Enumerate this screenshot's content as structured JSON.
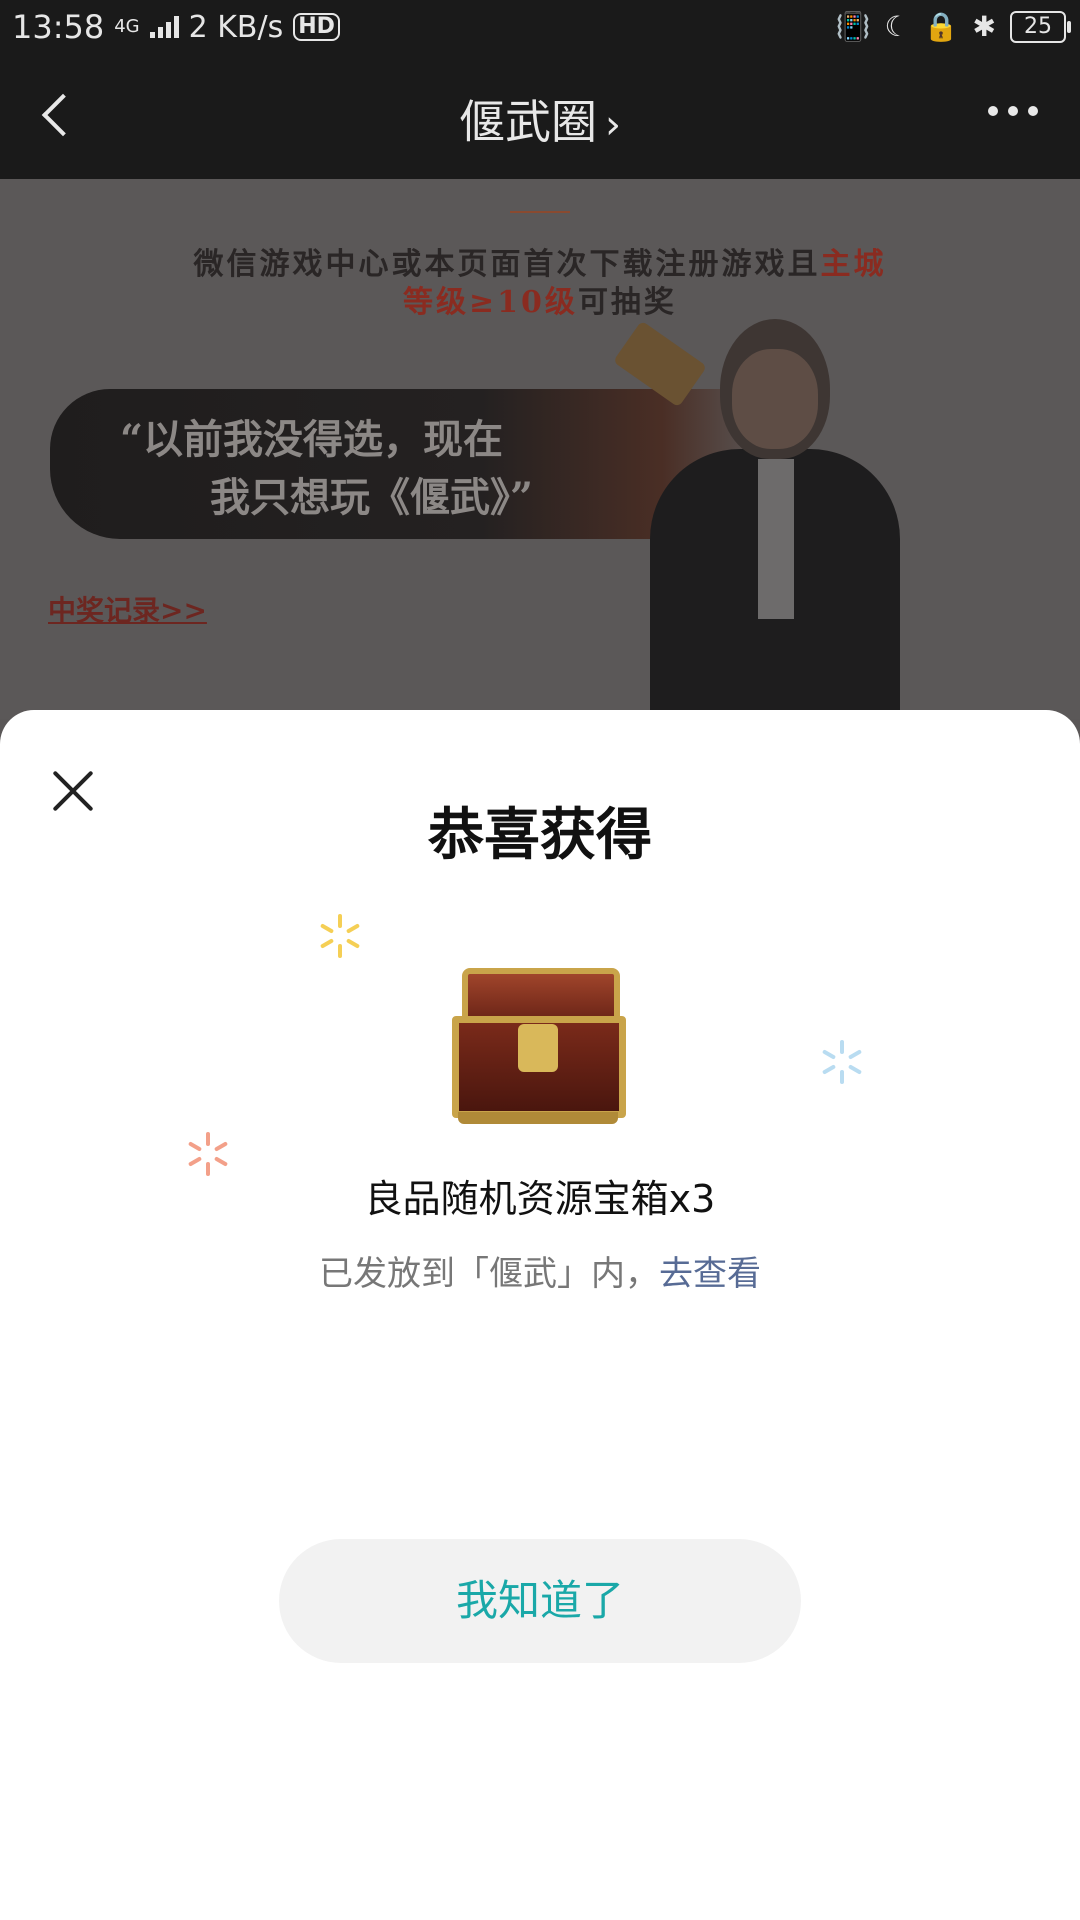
{
  "status_bar": {
    "time": "13:58",
    "network": "4G",
    "speed": "2 KB/s",
    "hd": "HD",
    "battery": "25"
  },
  "nav": {
    "title": "偃武圈",
    "title_chevron": "›",
    "back_icon": "chevron-left-icon",
    "more_icon": "more-dots-icon"
  },
  "background_page": {
    "top_line": "",
    "line1_a": "微信游戏中心或本页面首次下载注册游戏且",
    "line1_b": "主城",
    "line2_a": "等级≥10级",
    "line2_b": "可抽奖",
    "quote_1": "“以前我没得选，现在",
    "quote_2": "我只想玩《偃武》”",
    "record_link": "中奖记录>>"
  },
  "modal": {
    "title": "恭喜获得",
    "item_name": "良品随机资源宝箱x3",
    "delivered_text": "已发放到「偃武」内，",
    "view_link": "去查看",
    "ok_button": "我知道了"
  },
  "colors": {
    "accent_teal": "#1aa8a8",
    "link_blue": "#576b95",
    "sheet_bg": "#ffffff"
  }
}
